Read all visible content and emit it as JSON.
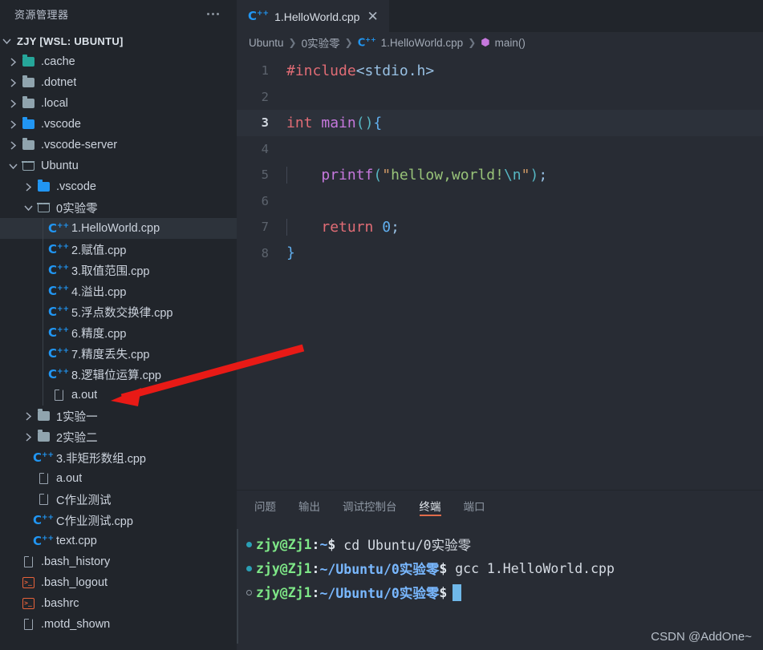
{
  "sidebar": {
    "title": "资源管理器",
    "more_icon": "ellipsis-icon",
    "root": {
      "label": "ZJY [WSL: UBUNTU]",
      "expanded": true
    },
    "items": [
      {
        "label": ".cache",
        "depth": 1,
        "type": "folder",
        "state": "collapsed",
        "color": "teal"
      },
      {
        "label": ".dotnet",
        "depth": 1,
        "type": "folder",
        "state": "collapsed",
        "color": "grey"
      },
      {
        "label": ".local",
        "depth": 1,
        "type": "folder",
        "state": "collapsed",
        "color": "grey"
      },
      {
        "label": ".vscode",
        "depth": 1,
        "type": "folder",
        "state": "collapsed",
        "color": "blue"
      },
      {
        "label": ".vscode-server",
        "depth": 1,
        "type": "folder",
        "state": "collapsed",
        "color": "grey"
      },
      {
        "label": "Ubuntu",
        "depth": 1,
        "type": "folder",
        "state": "expanded",
        "color": "grey"
      },
      {
        "label": ".vscode",
        "depth": 2,
        "type": "folder",
        "state": "collapsed",
        "color": "blue"
      },
      {
        "label": "0实验零",
        "depth": 2,
        "type": "folder",
        "state": "expanded",
        "color": "grey"
      },
      {
        "label": "1.HelloWorld.cpp",
        "depth": 3,
        "type": "cpp",
        "selected": true
      },
      {
        "label": "2.赋值.cpp",
        "depth": 3,
        "type": "cpp"
      },
      {
        "label": "3.取值范围.cpp",
        "depth": 3,
        "type": "cpp"
      },
      {
        "label": "4.溢出.cpp",
        "depth": 3,
        "type": "cpp"
      },
      {
        "label": "5.浮点数交换律.cpp",
        "depth": 3,
        "type": "cpp"
      },
      {
        "label": "6.精度.cpp",
        "depth": 3,
        "type": "cpp"
      },
      {
        "label": "7.精度丢失.cpp",
        "depth": 3,
        "type": "cpp"
      },
      {
        "label": "8.逻辑位运算.cpp",
        "depth": 3,
        "type": "cpp"
      },
      {
        "label": "a.out",
        "depth": 3,
        "type": "file"
      },
      {
        "label": "1实验一",
        "depth": 2,
        "type": "folder",
        "state": "collapsed",
        "color": "grey"
      },
      {
        "label": "2实验二",
        "depth": 2,
        "type": "folder",
        "state": "collapsed",
        "color": "grey"
      },
      {
        "label": "3.非矩形数组.cpp",
        "depth": 2,
        "type": "cpp"
      },
      {
        "label": "a.out",
        "depth": 2,
        "type": "file"
      },
      {
        "label": "C作业测试",
        "depth": 2,
        "type": "file"
      },
      {
        "label": "C作业测试.cpp",
        "depth": 2,
        "type": "cpp"
      },
      {
        "label": "text.cpp",
        "depth": 2,
        "type": "cpp"
      },
      {
        "label": ".bash_history",
        "depth": 1,
        "type": "file"
      },
      {
        "label": ".bash_logout",
        "depth": 1,
        "type": "terminal"
      },
      {
        "label": ".bashrc",
        "depth": 1,
        "type": "terminal"
      },
      {
        "label": ".motd_shown",
        "depth": 1,
        "type": "file"
      }
    ]
  },
  "annotation": {
    "arrow_color": "#e81a16",
    "points_at": "a.out"
  },
  "editor": {
    "tab": {
      "label": "1.HelloWorld.cpp",
      "icon": "cpp-icon",
      "close_icon": "close-icon"
    },
    "breadcrumb": [
      "Ubuntu",
      "0实验零",
      "1.HelloWorld.cpp",
      "main()"
    ],
    "active_line": 3,
    "lines": [
      {
        "n": 1,
        "tokens": [
          {
            "t": "#include",
            "c": "k-pre"
          },
          {
            "t": "<stdio.h>",
            "c": "k-inc"
          }
        ]
      },
      {
        "n": 2,
        "tokens": []
      },
      {
        "n": 3,
        "tokens": [
          {
            "t": "int ",
            "c": "k-type"
          },
          {
            "t": "main",
            "c": "k-fn"
          },
          {
            "t": "(",
            "c": "k-par"
          },
          {
            "t": ")",
            "c": "k-par"
          },
          {
            "t": "{",
            "c": "k-brc"
          }
        ]
      },
      {
        "n": 4,
        "tokens": []
      },
      {
        "n": 5,
        "tokens": [
          {
            "t": "    ",
            "c": ""
          },
          {
            "t": "printf",
            "c": "k-fn"
          },
          {
            "t": "(",
            "c": "k-par"
          },
          {
            "t": "\"",
            "c": "k-qt"
          },
          {
            "t": "hellow,world!",
            "c": "k-str"
          },
          {
            "t": "\\n",
            "c": "k-esc"
          },
          {
            "t": "\"",
            "c": "k-qt"
          },
          {
            "t": ")",
            "c": "k-par"
          },
          {
            "t": ";",
            "c": "k-pun"
          }
        ]
      },
      {
        "n": 6,
        "tokens": []
      },
      {
        "n": 7,
        "tokens": [
          {
            "t": "    ",
            "c": ""
          },
          {
            "t": "return ",
            "c": "k-type"
          },
          {
            "t": "0",
            "c": "k-num"
          },
          {
            "t": ";",
            "c": "k-pun"
          }
        ]
      },
      {
        "n": 8,
        "tokens": [
          {
            "t": "}",
            "c": "k-brc"
          }
        ]
      }
    ]
  },
  "panel": {
    "tabs": [
      {
        "label": "问题",
        "active": false
      },
      {
        "label": "输出",
        "active": false
      },
      {
        "label": "调试控制台",
        "active": false
      },
      {
        "label": "终端",
        "active": true
      },
      {
        "label": "端口",
        "active": false
      }
    ],
    "terminal": {
      "lines": [
        {
          "marker": "filled",
          "user": "zjy@Zj1",
          "colon": ":",
          "path": "~",
          "dollar": "$",
          "cmd": " cd Ubuntu/0实验零",
          "cursor": false
        },
        {
          "marker": "filled",
          "user": "zjy@Zj1",
          "colon": ":",
          "path": "~/Ubuntu/0实验零",
          "dollar": "$",
          "cmd": " gcc 1.HelloWorld.cpp",
          "cursor": false
        },
        {
          "marker": "hollow",
          "user": "zjy@Zj1",
          "colon": ":",
          "path": "~/Ubuntu/0实验零",
          "dollar": "$",
          "cmd": "",
          "cursor": true
        }
      ]
    }
  },
  "watermark": "CSDN @AddOne~"
}
